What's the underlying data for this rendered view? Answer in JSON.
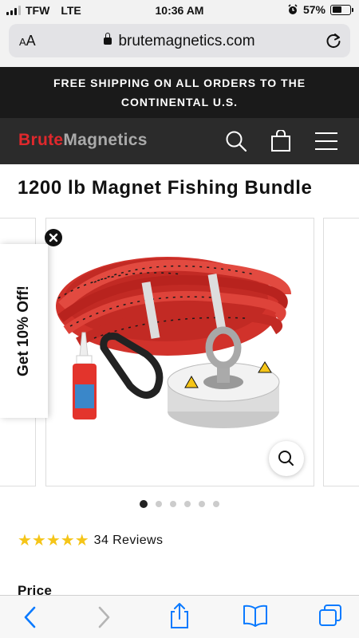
{
  "status_bar": {
    "carrier": "TFW",
    "network": "LTE",
    "time": "10:36 AM",
    "battery": "57%",
    "battery_level": 0.57
  },
  "address_bar": {
    "text_size_label_small": "A",
    "text_size_label_large": "A",
    "url": "brutemagnetics.com"
  },
  "promo_banner": {
    "line1": "FREE SHIPPING ON ALL ORDERS TO THE",
    "line2": "CONTINENTAL U.S."
  },
  "header": {
    "logo_part1": "Brute",
    "logo_part2": "Magnetics",
    "icons": [
      "search-icon",
      "shopping-bag-icon",
      "menu-icon"
    ]
  },
  "product": {
    "title": "1200 lb Magnet Fishing Bundle",
    "rating": 5,
    "review_count": "34 Reviews",
    "price_label": "Price",
    "gallery_slide_count": 6,
    "gallery_active_index": 0
  },
  "popup": {
    "discount_text": "Get 10% Off!"
  },
  "toolbar": {
    "icons": [
      "back-icon",
      "forward-icon",
      "share-icon",
      "bookmarks-icon",
      "tabs-icon"
    ]
  },
  "colors": {
    "brand_red": "#e0282c",
    "header_bg": "#2b2b2b",
    "banner_bg": "#1a1a1a",
    "star": "#f5c518",
    "ios_blue": "#0a7aff"
  }
}
